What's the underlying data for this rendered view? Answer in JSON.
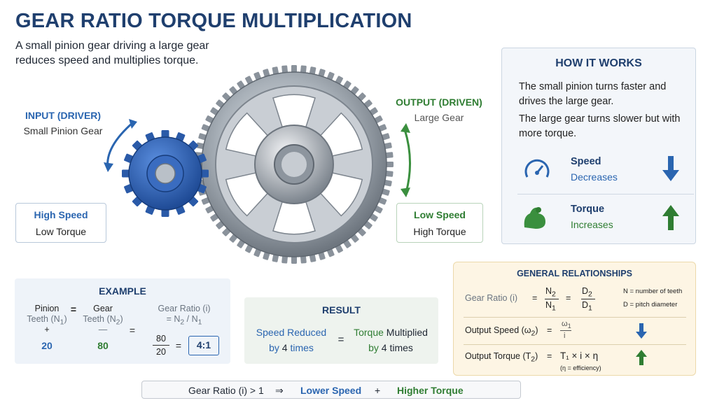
{
  "header": {
    "title": "GEAR RATIO TORQUE MULTIPLICATION",
    "subtitle": "A small pinion gear driving a large gear reduces speed and multiplies torque."
  },
  "input": {
    "heading": "INPUT (DRIVER)",
    "label": "Small Pinion Gear"
  },
  "output": {
    "heading": "OUTPUT (DRIVEN)",
    "label": "Large Gear"
  },
  "input_box": {
    "line1": "High Speed",
    "line2": "Low Torque"
  },
  "output_box": {
    "line1": "Low Speed",
    "line2": "High Torque"
  },
  "how": {
    "title": "HOW IT WORKS",
    "p1": "The small pinion turns faster and drives the large gear.",
    "p2": "The large gear turns slower but with more torque.",
    "speed": {
      "label": "Speed",
      "value": "Decreases",
      "icon": "speedometer-icon"
    },
    "torque": {
      "label": "Torque",
      "value": "Increases",
      "icon": "flexed-arm-icon"
    }
  },
  "example": {
    "title": "EXAMPLE",
    "pinion": "Pinion",
    "pinion_teeth_prefix": "Teeth (N",
    "pinion_teeth_sub": "1",
    "pinion_value": "20",
    "gear": "Gear",
    "gear_teeth_prefix": "Teeth (N",
    "gear_teeth_sub": "2",
    "gear_value": "80",
    "ratio_label": "Gear Ratio (i)",
    "ratio_formula_a": "= N",
    "ratio_formula_sub1": "2",
    "ratio_formula_b": " / N",
    "ratio_formula_sub2": "1",
    "frac_num": "80",
    "frac_den": "20",
    "ratio_result": "4:1",
    "equals": "=",
    "plus": "+",
    "dash": "—"
  },
  "result": {
    "title": "RESULT",
    "left_line1": "Speed Reduced",
    "left_line2_a": "by ",
    "left_line2_b": "4",
    "left_line2_c": " times",
    "right_line1_a": "Torque",
    "right_line1_b": " Multiplied",
    "right_line2_a": "by ",
    "right_line2_b": "4",
    "right_line2_c": " times",
    "equals": "="
  },
  "relationships": {
    "title": "GENERAL RELATIONSHIPS",
    "ratio_label": "Gear Ratio (i)",
    "eq": "=",
    "n2": "N",
    "n2_sub": "2",
    "n1": "N",
    "n1_sub": "1",
    "d2": "D",
    "d2_sub": "2",
    "d1": "D",
    "d1_sub": "1",
    "note_n": "N = number of teeth",
    "note_d": "D = pitch diameter",
    "speed_label": "Output Speed (ω",
    "speed_label_sub": "2",
    "speed_label_end": ")",
    "speed_num": "ω",
    "speed_num_sub": "1",
    "speed_den": "i",
    "torque_label": "Output Torque (T",
    "torque_label_sub": "2",
    "torque_label_end": ")",
    "torque_formula": "T₁ × i × η",
    "efficiency_note": "(η = efficiency)"
  },
  "bottom": {
    "condition": "Gear Ratio (i) > 1",
    "implies": "⇒",
    "lower_speed": "Lower Speed",
    "plus": "+",
    "higher_torque": "Higher Torque"
  },
  "colors": {
    "title": "#1f3f6e",
    "blue": "#2a65b0",
    "green": "#2f7d32",
    "pinion": "#2d5fb0",
    "gear": "#9aa2ab"
  }
}
